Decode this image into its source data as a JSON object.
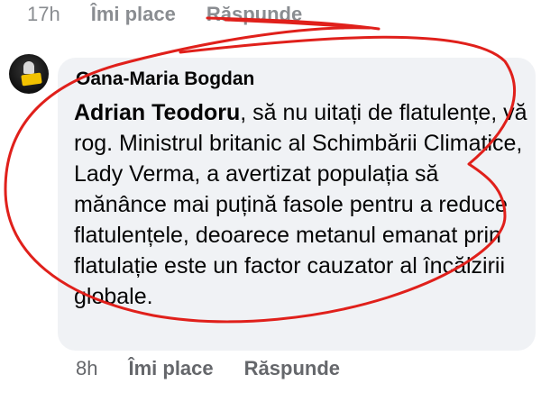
{
  "previous_comment": {
    "time": "17h",
    "like_label": "Îmi place",
    "reply_label": "Răspunde"
  },
  "comment": {
    "author": "Oana-Maria Bogdan",
    "mention": "Adrian Teodoru",
    "text": ", să nu uitați de flatulențe, vă rog. Ministrul britanic al Schimbării Climatice, Lady Verma, a avertizat populația să mănânce mai puțină fasole pentru a reduce flatulențele, deoarece metanul emanat prin flatulație este un factor cauzator al încălzirii globale."
  },
  "comment_actions": {
    "time": "8h",
    "like_label": "Îmi place",
    "reply_label": "Răspunde"
  },
  "colors": {
    "annotation_red": "#e0201b",
    "bubble_bg": "#f0f2f5"
  }
}
